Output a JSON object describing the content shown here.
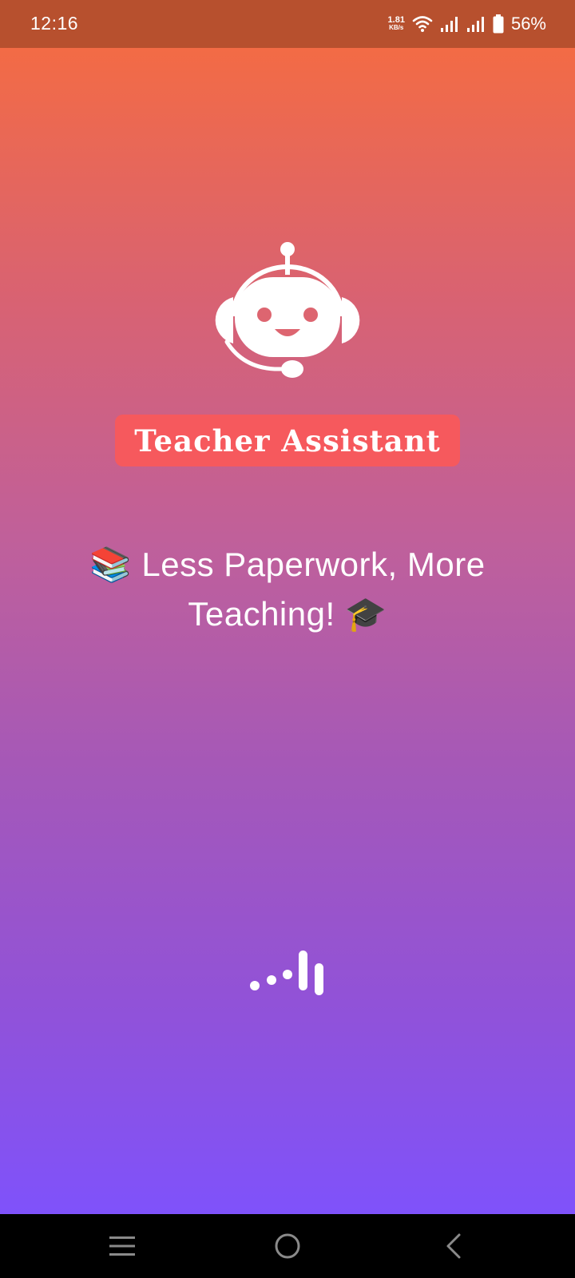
{
  "status_bar": {
    "time": "12:16",
    "net_speed_value": "1.81",
    "net_speed_unit": "KB/s",
    "battery": "56%",
    "icons": [
      "wifi-icon",
      "signal-icon",
      "signal-icon",
      "battery-icon"
    ]
  },
  "splash": {
    "logo_icon": "robot-headset-icon",
    "brand_title": "Teacher Assistant",
    "tagline_emoji_start": "📚",
    "tagline_text": "Less Paperwork, More Teaching!",
    "tagline_emoji_end": "🎓",
    "loader_icon": "loading-bars-icon"
  },
  "colors": {
    "status_bar": "#b7502e",
    "gradient_top": "#f36b45",
    "gradient_bottom": "#7f52fb",
    "badge": "#f6595d"
  },
  "nav_bar": {
    "icons": [
      "menu-icon",
      "home-icon",
      "back-icon"
    ]
  }
}
